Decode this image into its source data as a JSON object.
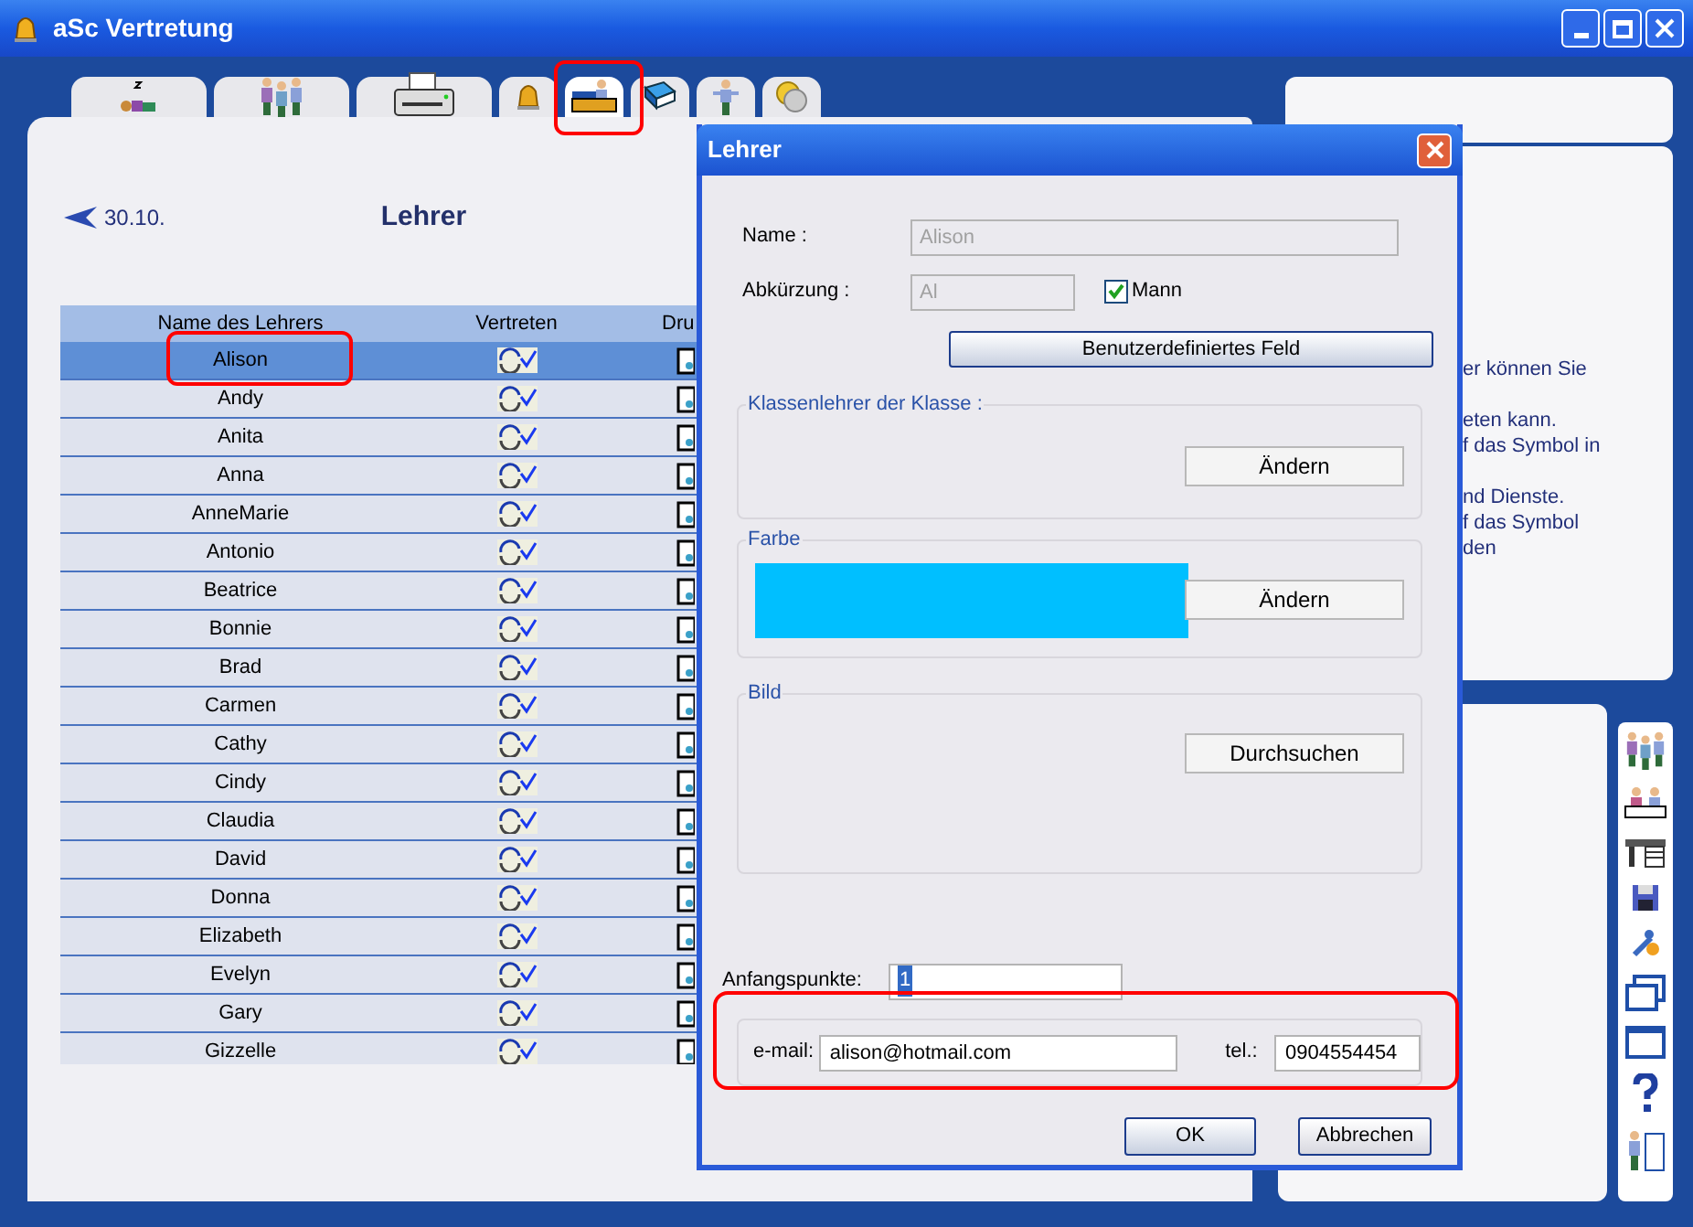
{
  "window": {
    "title": "aSc Vertretung"
  },
  "tabs": [
    {
      "selected": false
    },
    {
      "selected": false
    },
    {
      "selected": false
    },
    {
      "selected": false
    },
    {
      "selected": true
    },
    {
      "selected": false
    },
    {
      "selected": false
    },
    {
      "selected": false
    }
  ],
  "header": {
    "back_date": "30.10.",
    "title": "Lehrer"
  },
  "table": {
    "columns": [
      "Name des Lehrers",
      "Vertreten",
      "Dru"
    ],
    "rows": [
      {
        "name": "Alison",
        "selected": true
      },
      {
        "name": "Andy",
        "selected": false
      },
      {
        "name": "Anita",
        "selected": false
      },
      {
        "name": "Anna",
        "selected": false
      },
      {
        "name": "AnneMarie",
        "selected": false
      },
      {
        "name": "Antonio",
        "selected": false
      },
      {
        "name": "Beatrice",
        "selected": false
      },
      {
        "name": "Bonnie",
        "selected": false
      },
      {
        "name": "Brad",
        "selected": false
      },
      {
        "name": "Carmen",
        "selected": false
      },
      {
        "name": "Cathy",
        "selected": false
      },
      {
        "name": "Cindy",
        "selected": false
      },
      {
        "name": "Claudia",
        "selected": false
      },
      {
        "name": "David",
        "selected": false
      },
      {
        "name": "Donna",
        "selected": false
      },
      {
        "name": "Elizabeth",
        "selected": false
      },
      {
        "name": "Evelyn",
        "selected": false
      },
      {
        "name": "Gary",
        "selected": false
      },
      {
        "name": "Gizzelle",
        "selected": false
      }
    ]
  },
  "help_panel": {
    "paragraphs": [
      [
        "er können Sie"
      ],
      [
        "eten kann.",
        "f das Symbol in"
      ],
      [
        "nd Dienste.",
        "f das Symbol",
        "den"
      ]
    ]
  },
  "dialog": {
    "title": "Lehrer",
    "name_label": "Name :",
    "name_value": "Alison",
    "abbr_label": "Abkürzung :",
    "abbr_value": "Al",
    "mann": {
      "label": "Mann",
      "checked": true
    },
    "custom_button": "Benutzerdefiniertes Feld",
    "class_group": {
      "legend": "Klassenlehrer der Klasse :",
      "button": "Ändern"
    },
    "color_group": {
      "legend": "Farbe",
      "color": "#00bfff",
      "button": "Ändern"
    },
    "picture_group": {
      "legend": "Bild",
      "button": "Durchsuchen"
    },
    "points_label": "Anfangspunkte:",
    "points_value": "1",
    "email_label": "e-mail:",
    "email_value": "alison@hotmail.com",
    "tel_label": "tel.:",
    "tel_value": "0904554454",
    "ok": "OK",
    "cancel": "Abbrechen"
  }
}
